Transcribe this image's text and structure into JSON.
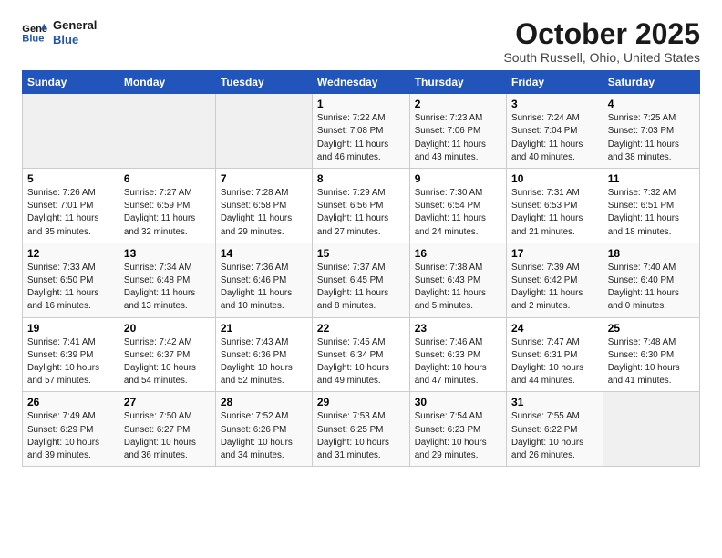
{
  "logo": {
    "line1": "General",
    "line2": "Blue"
  },
  "title": "October 2025",
  "location": "South Russell, Ohio, United States",
  "days_header": [
    "Sunday",
    "Monday",
    "Tuesday",
    "Wednesday",
    "Thursday",
    "Friday",
    "Saturday"
  ],
  "rows": [
    [
      {
        "num": "",
        "info": ""
      },
      {
        "num": "",
        "info": ""
      },
      {
        "num": "",
        "info": ""
      },
      {
        "num": "1",
        "info": "Sunrise: 7:22 AM\nSunset: 7:08 PM\nDaylight: 11 hours\nand 46 minutes."
      },
      {
        "num": "2",
        "info": "Sunrise: 7:23 AM\nSunset: 7:06 PM\nDaylight: 11 hours\nand 43 minutes."
      },
      {
        "num": "3",
        "info": "Sunrise: 7:24 AM\nSunset: 7:04 PM\nDaylight: 11 hours\nand 40 minutes."
      },
      {
        "num": "4",
        "info": "Sunrise: 7:25 AM\nSunset: 7:03 PM\nDaylight: 11 hours\nand 38 minutes."
      }
    ],
    [
      {
        "num": "5",
        "info": "Sunrise: 7:26 AM\nSunset: 7:01 PM\nDaylight: 11 hours\nand 35 minutes."
      },
      {
        "num": "6",
        "info": "Sunrise: 7:27 AM\nSunset: 6:59 PM\nDaylight: 11 hours\nand 32 minutes."
      },
      {
        "num": "7",
        "info": "Sunrise: 7:28 AM\nSunset: 6:58 PM\nDaylight: 11 hours\nand 29 minutes."
      },
      {
        "num": "8",
        "info": "Sunrise: 7:29 AM\nSunset: 6:56 PM\nDaylight: 11 hours\nand 27 minutes."
      },
      {
        "num": "9",
        "info": "Sunrise: 7:30 AM\nSunset: 6:54 PM\nDaylight: 11 hours\nand 24 minutes."
      },
      {
        "num": "10",
        "info": "Sunrise: 7:31 AM\nSunset: 6:53 PM\nDaylight: 11 hours\nand 21 minutes."
      },
      {
        "num": "11",
        "info": "Sunrise: 7:32 AM\nSunset: 6:51 PM\nDaylight: 11 hours\nand 18 minutes."
      }
    ],
    [
      {
        "num": "12",
        "info": "Sunrise: 7:33 AM\nSunset: 6:50 PM\nDaylight: 11 hours\nand 16 minutes."
      },
      {
        "num": "13",
        "info": "Sunrise: 7:34 AM\nSunset: 6:48 PM\nDaylight: 11 hours\nand 13 minutes."
      },
      {
        "num": "14",
        "info": "Sunrise: 7:36 AM\nSunset: 6:46 PM\nDaylight: 11 hours\nand 10 minutes."
      },
      {
        "num": "15",
        "info": "Sunrise: 7:37 AM\nSunset: 6:45 PM\nDaylight: 11 hours\nand 8 minutes."
      },
      {
        "num": "16",
        "info": "Sunrise: 7:38 AM\nSunset: 6:43 PM\nDaylight: 11 hours\nand 5 minutes."
      },
      {
        "num": "17",
        "info": "Sunrise: 7:39 AM\nSunset: 6:42 PM\nDaylight: 11 hours\nand 2 minutes."
      },
      {
        "num": "18",
        "info": "Sunrise: 7:40 AM\nSunset: 6:40 PM\nDaylight: 11 hours\nand 0 minutes."
      }
    ],
    [
      {
        "num": "19",
        "info": "Sunrise: 7:41 AM\nSunset: 6:39 PM\nDaylight: 10 hours\nand 57 minutes."
      },
      {
        "num": "20",
        "info": "Sunrise: 7:42 AM\nSunset: 6:37 PM\nDaylight: 10 hours\nand 54 minutes."
      },
      {
        "num": "21",
        "info": "Sunrise: 7:43 AM\nSunset: 6:36 PM\nDaylight: 10 hours\nand 52 minutes."
      },
      {
        "num": "22",
        "info": "Sunrise: 7:45 AM\nSunset: 6:34 PM\nDaylight: 10 hours\nand 49 minutes."
      },
      {
        "num": "23",
        "info": "Sunrise: 7:46 AM\nSunset: 6:33 PM\nDaylight: 10 hours\nand 47 minutes."
      },
      {
        "num": "24",
        "info": "Sunrise: 7:47 AM\nSunset: 6:31 PM\nDaylight: 10 hours\nand 44 minutes."
      },
      {
        "num": "25",
        "info": "Sunrise: 7:48 AM\nSunset: 6:30 PM\nDaylight: 10 hours\nand 41 minutes."
      }
    ],
    [
      {
        "num": "26",
        "info": "Sunrise: 7:49 AM\nSunset: 6:29 PM\nDaylight: 10 hours\nand 39 minutes."
      },
      {
        "num": "27",
        "info": "Sunrise: 7:50 AM\nSunset: 6:27 PM\nDaylight: 10 hours\nand 36 minutes."
      },
      {
        "num": "28",
        "info": "Sunrise: 7:52 AM\nSunset: 6:26 PM\nDaylight: 10 hours\nand 34 minutes."
      },
      {
        "num": "29",
        "info": "Sunrise: 7:53 AM\nSunset: 6:25 PM\nDaylight: 10 hours\nand 31 minutes."
      },
      {
        "num": "30",
        "info": "Sunrise: 7:54 AM\nSunset: 6:23 PM\nDaylight: 10 hours\nand 29 minutes."
      },
      {
        "num": "31",
        "info": "Sunrise: 7:55 AM\nSunset: 6:22 PM\nDaylight: 10 hours\nand 26 minutes."
      },
      {
        "num": "",
        "info": ""
      }
    ]
  ]
}
